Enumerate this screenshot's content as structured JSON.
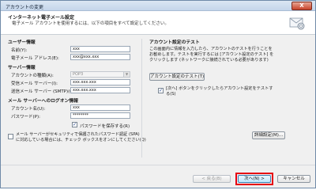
{
  "window": {
    "title": "アカウントの変更",
    "close_label": "X"
  },
  "header": {
    "title": "インターネット電子メール設定",
    "subtitle": "電子メール アカウントを使用するには、以下の項目をすべて設定してください。"
  },
  "left": {
    "user_info": {
      "heading": "ユーザー情報",
      "name_label": "名前(Y):",
      "name_value": "xxx",
      "email_label": "電子メール アドレス(E):",
      "email_value": "xxx@xxx.xxx"
    },
    "server_info": {
      "heading": "サーバー情報",
      "account_type_label": "アカウントの種類(A):",
      "account_type_value": "POP3",
      "incoming_label": "受信メール サーバー(I):",
      "incoming_value": "xxx.xxx.xxx",
      "outgoing_label": "送信メール サーバー (SMTP)(O):",
      "outgoing_value": "xxx.xxx.xxx"
    },
    "logon_info": {
      "heading": "メール サーバーへのログオン情報",
      "account_name_label": "アカウント名(U):",
      "account_name_value": "xxx",
      "password_label": "パスワード(P):",
      "password_value": "********",
      "remember_label": "パスワードを保存する(R)",
      "spa_label_line1": "メール サーバーがセキュリティで保護されたパスワード認証 (SPA)",
      "spa_label_line2": "に対応している場合には、チェック ボックスをオンにしてください(Q)"
    }
  },
  "right": {
    "heading": "アカウント設定のテスト",
    "desc_line1": "この画面内に情報を入力したら、アカウントのテストを行うことを",
    "desc_line2": "お勧めします。テストを実行するには [アカウント設定のテスト] を",
    "desc_line3": "クリックします (ネットワークに接続されている必要があります)",
    "test_button": "アカウント設定のテスト(T)",
    "auto_test_line1": "[次へ] ボタンをクリックしたらアカウント設定をテストす",
    "auto_test_line2": "る(S)",
    "more_settings_button": "詳細設定(M)..."
  },
  "footer": {
    "back_button": "< 戻る(B)",
    "next_button": "次へ(N) >",
    "cancel_button": "キャンセル"
  }
}
